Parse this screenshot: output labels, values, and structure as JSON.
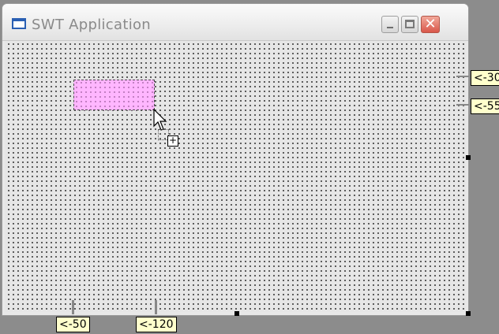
{
  "window": {
    "title": "SWT Application"
  },
  "designer": {
    "left_attachments": [
      "<-50",
      "<-120"
    ],
    "top_attachments": [
      "<-30",
      "<-55"
    ]
  },
  "colors": {
    "selection_fill": "#ffb6ff",
    "guide_tag_bg": "#ffffcc",
    "background": "#8c8c8c"
  },
  "icons": [
    "app-window-icon",
    "minimize-icon",
    "maximize-icon",
    "close-icon",
    "arrow-cursor-icon",
    "drag-add-icon"
  ]
}
